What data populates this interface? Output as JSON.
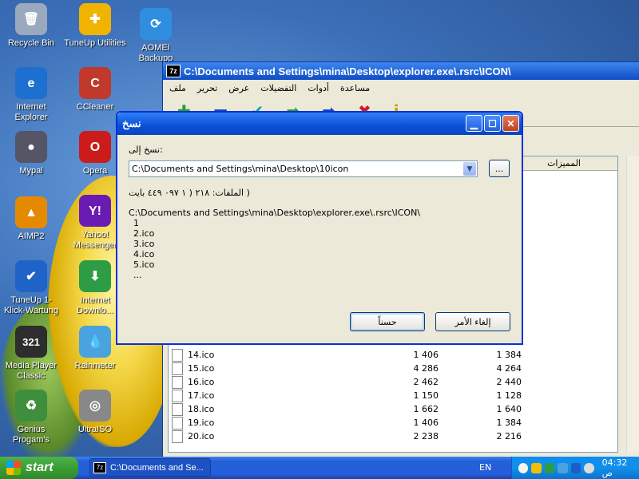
{
  "desktop": {
    "icons": [
      {
        "label": "Recycle Bin",
        "glyph": "🗑",
        "color": "#9aa9bd"
      },
      {
        "label": "TuneUp Utilities",
        "glyph": "✚",
        "color": "#f0b400"
      },
      {
        "label": "AOMEI Backupp",
        "glyph": "⟳",
        "color": "#2f8ee0"
      },
      {
        "label": "Internet Explorer",
        "glyph": "e",
        "color": "#1d6fd0"
      },
      {
        "label": "CCleaner",
        "glyph": "C",
        "color": "#c0392b"
      },
      {
        "label": "Mypal",
        "glyph": "●",
        "color": "#556"
      },
      {
        "label": "Opera",
        "glyph": "O",
        "color": "#cc1b1b"
      },
      {
        "label": "AIMP2",
        "glyph": "▲",
        "color": "#e58a00"
      },
      {
        "label": "Yahoo! Messenger",
        "glyph": "Y!",
        "color": "#6a1bb3"
      },
      {
        "label": "TuneUp 1-Klick-Wartung",
        "glyph": "✔",
        "color": "#1f63c8"
      },
      {
        "label": "Internet Downlo...",
        "glyph": "⬇",
        "color": "#2e9b45"
      },
      {
        "label": "Media Player Classic",
        "glyph": "321",
        "color": "#2d2d2d"
      },
      {
        "label": "Rainmeter",
        "glyph": "💧",
        "color": "#4aa3df"
      },
      {
        "label": "Genius Progam's",
        "glyph": "♻",
        "color": "#3e8e3e"
      },
      {
        "label": "UltraISO",
        "glyph": "◎",
        "color": "#888"
      }
    ]
  },
  "explorer": {
    "app_icon": "7z",
    "title": "C:\\Documents and Settings\\mina\\Desktop\\explorer.exe\\.rsrc\\ICON\\",
    "menu": [
      "ملف",
      "تحرير",
      "عرض",
      "التفضيلات",
      "أدوات",
      "مساعدة"
    ],
    "column_header": "المميزات",
    "rows": [
      {
        "name": "14.ico",
        "size": "1 406",
        "packed": "1 384"
      },
      {
        "name": "15.ico",
        "size": "4 286",
        "packed": "4 264"
      },
      {
        "name": "16.ico",
        "size": "2 462",
        "packed": "2 440"
      },
      {
        "name": "17.ico",
        "size": "1 150",
        "packed": "1 128"
      },
      {
        "name": "18.ico",
        "size": "1 662",
        "packed": "1 640"
      },
      {
        "name": "19.ico",
        "size": "1 406",
        "packed": "1 384"
      },
      {
        "name": "20.ico",
        "size": "2 238",
        "packed": "2 216"
      }
    ]
  },
  "dialog": {
    "title": "نسخ",
    "copy_to_label": "نسخ إلى:",
    "destination_value": "C:\\Documents and Settings\\mina\\Desktop\\10icon",
    "browse_label": "...",
    "files_info": "( الملفات: ٢١٨   ( ١ ٠٩٧ ٤٤٩ بايت",
    "source_path": "C:\\Documents and Settings\\mina\\Desktop\\explorer.exe\\.rsrc\\ICON\\",
    "files": [
      "1",
      "2.ico",
      "3.ico",
      "4.ico",
      "5.ico",
      "..."
    ],
    "ok_label": "حسناً",
    "cancel_label": "إلغاء الأمر"
  },
  "taskbar": {
    "start_label": "start",
    "task_label": "C:\\Documents and Se...",
    "task_icon": "7z",
    "language": "EN",
    "clock": "04:32 ص"
  }
}
